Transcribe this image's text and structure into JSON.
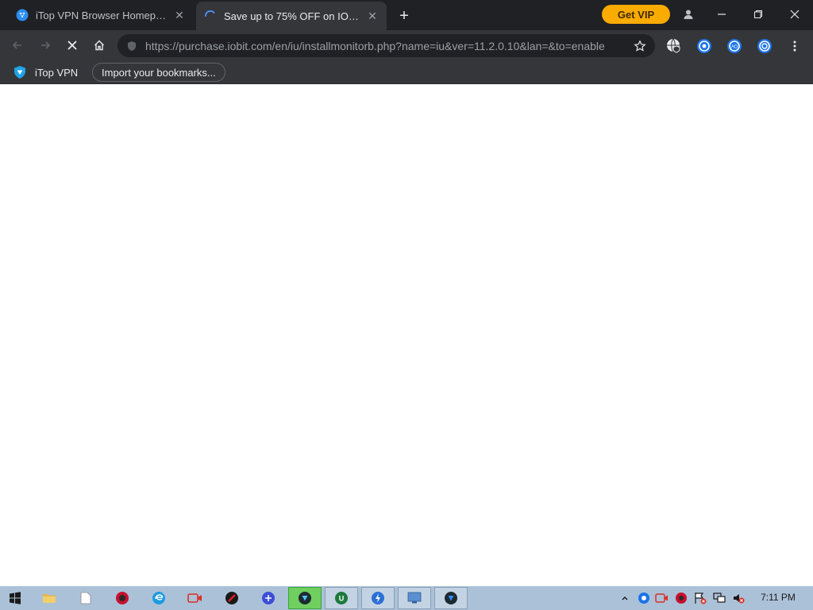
{
  "tabs": [
    {
      "title": "iTop VPN Browser Homepage",
      "state": "inactive",
      "icon": "itop-vpn-icon"
    },
    {
      "title": "Save up to 75% OFF on IObit ...",
      "state": "active-loading",
      "icon": "loading-spinner-icon"
    }
  ],
  "header": {
    "get_vip_label": "Get VIP",
    "get_vip_color": "#f9ab00"
  },
  "address_bar": {
    "url": "https://purchase.iobit.com/en/iu/installmonitorb.php?name=iu&ver=11.2.0.10&lan=&to=enable"
  },
  "bookmarks": {
    "items": [
      {
        "label": "iTop VPN",
        "icon": "itop-vpn-icon"
      },
      {
        "label": "Import your bookmarks..."
      }
    ]
  },
  "taskbar": {
    "clock": "7:11 PM"
  },
  "colors": {
    "tabstrip_bg": "#202124",
    "toolbar_bg": "#35363a",
    "accent_blue": "#4f8ef7",
    "taskbar_bg": "#abc1d8"
  }
}
